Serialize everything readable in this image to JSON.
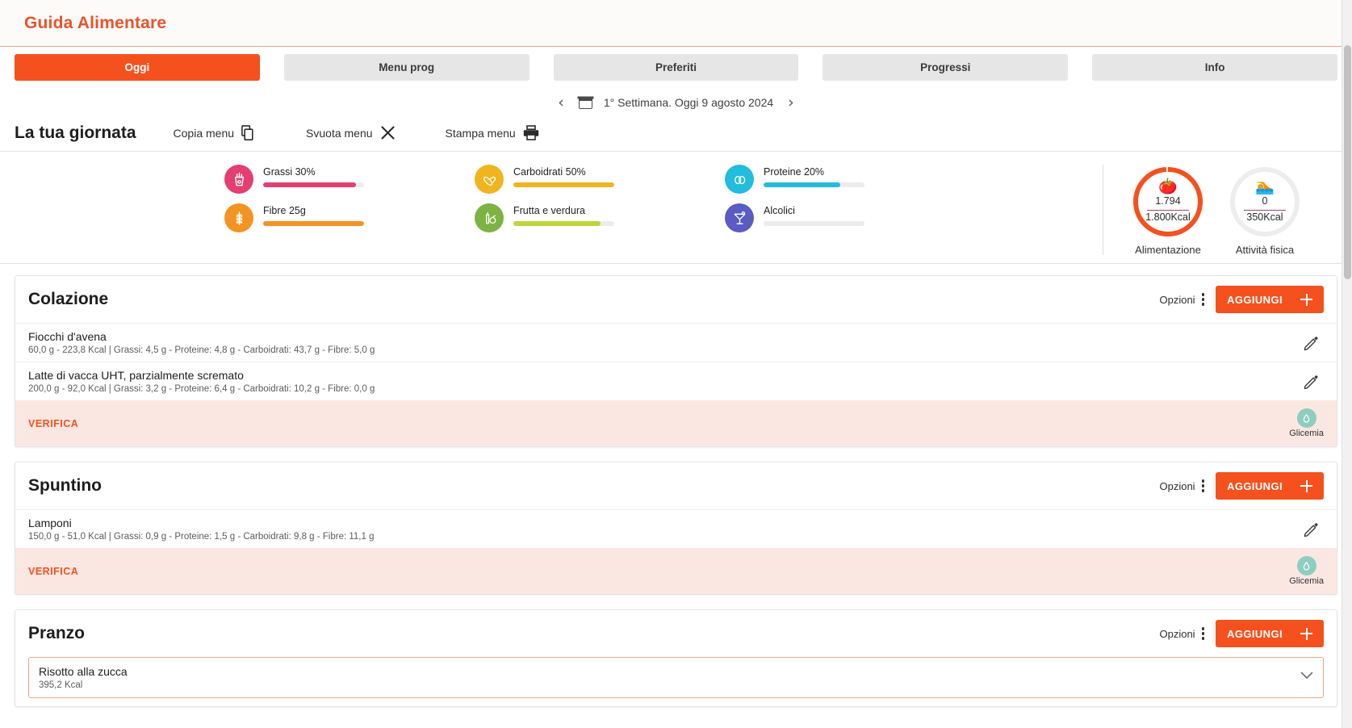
{
  "header": {
    "title": "Guida Alimentare"
  },
  "tabs": [
    {
      "label": "Oggi",
      "active": true
    },
    {
      "label": "Menu prog",
      "active": false
    },
    {
      "label": "Preferiti",
      "active": false
    },
    {
      "label": "Progressi",
      "active": false
    },
    {
      "label": "Info",
      "active": false
    }
  ],
  "datenav": {
    "prev": "‹",
    "next": "›",
    "label": "1° Settimana. Oggi 9 agosto 2024",
    "calendar_icon": "calendar-icon"
  },
  "daybar": {
    "title": "La tua giornata",
    "tools": [
      {
        "label": "Copia menu",
        "icon": "copy-icon"
      },
      {
        "label": "Svuota menu",
        "icon": "close-x-icon"
      },
      {
        "label": "Stampa menu",
        "icon": "printer-icon"
      }
    ]
  },
  "macros": [
    {
      "label": "Grassi 30%",
      "icon": "fries-icon",
      "color": "#e43e72",
      "fill_pct": 92,
      "track": "#ececec"
    },
    {
      "label": "Fibre 25g",
      "icon": "wheat-icon",
      "color": "#f39322",
      "fill_pct": 100,
      "track": "#ececec"
    },
    {
      "label": "Carboidrati 50%",
      "icon": "pasta-icon",
      "color": "#f0b41f",
      "fill_pct": 100,
      "track": "#ececec"
    },
    {
      "label": "Frutta e verdura",
      "icon": "fruit-veg-icon",
      "color": "#bdd63b",
      "fill_pct": 86,
      "track": "#ececec"
    },
    {
      "label": "Proteine 20%",
      "icon": "eggs-icon",
      "color": "#22bcdc",
      "fill_pct": 76,
      "track": "#ececec"
    },
    {
      "label": "Alcolici",
      "icon": "cocktail-icon",
      "color": "#5b5bc4",
      "fill_pct": 0,
      "track": "#ececec"
    }
  ],
  "rings": [
    {
      "emoji": "🍅",
      "value": "1.794",
      "goal": "1.800Kcal",
      "caption": "Alimentazione",
      "color": "#f4511e",
      "track": "#ededed",
      "progress_pct": 99
    },
    {
      "emoji": "🏊",
      "value": "0",
      "goal": "350Kcal",
      "caption": "Attività fisica",
      "color": "#22bcdc",
      "track": "#ededed",
      "progress_pct": 0
    }
  ],
  "meals": [
    {
      "name": "Colazione",
      "options_label": "Opzioni",
      "add_label": "AGGIUNGI",
      "foods": [
        {
          "name": "Fiocchi d'avena",
          "meta": "60,0 g - 223,8 Kcal   |   Grassi: 4,5 g  - Proteine: 4,8 g  - Carboidrati: 43,7 g  - Fibre: 5,0 g"
        },
        {
          "name": "Latte di vacca UHT, parzialmente scremato",
          "meta": "200,0 g - 92,0 Kcal   |   Grassi: 3,2 g  - Proteine: 6,4 g  - Carboidrati: 10,2 g  - Fibre: 0,0 g"
        }
      ],
      "verifica_label": "VERIFICA",
      "glicemia_label": "Glicemia"
    },
    {
      "name": "Spuntino",
      "options_label": "Opzioni",
      "add_label": "AGGIUNGI",
      "foods": [
        {
          "name": "Lamponi",
          "meta": "150,0 g - 51,0 Kcal   |   Grassi: 0,9 g  - Proteine: 1,5 g  - Carboidrati: 9,8 g  - Fibre: 11,1 g"
        }
      ],
      "verifica_label": "VERIFICA",
      "glicemia_label": "Glicemia"
    },
    {
      "name": "Pranzo",
      "options_label": "Opzioni",
      "add_label": "AGGIUNGI",
      "recipe": {
        "name": "Risotto alla zucca",
        "kcal": "395,2 Kcal"
      }
    }
  ]
}
